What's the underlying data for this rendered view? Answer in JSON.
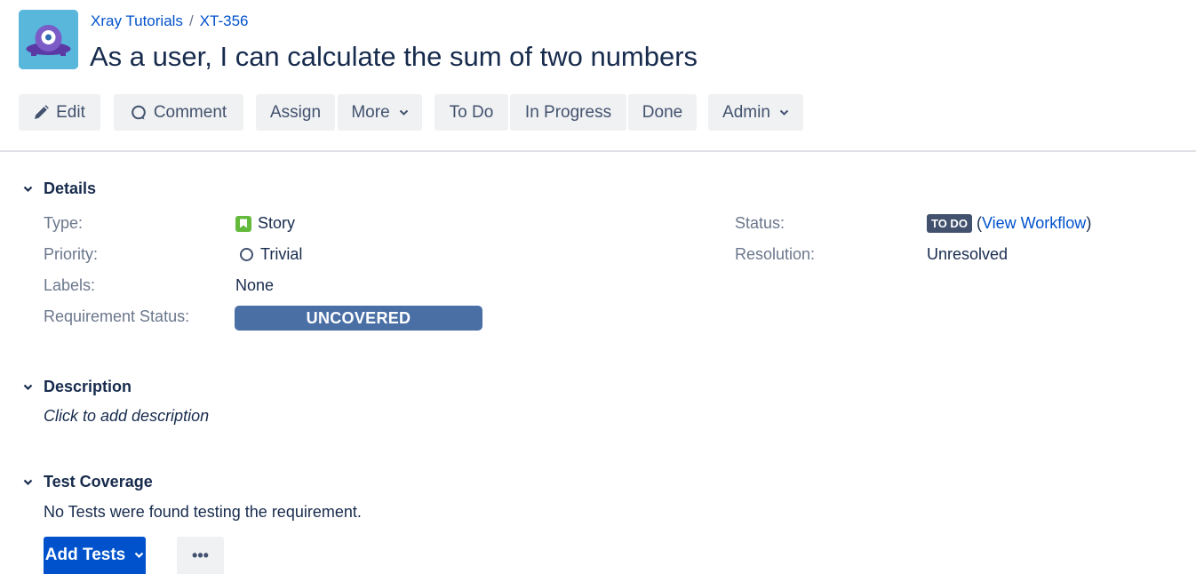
{
  "header": {
    "project": "Xray Tutorials",
    "separator": "/",
    "issue_key": "XT-356",
    "title": "As a user, I can calculate the sum of two numbers",
    "avatar_icon": "xray-project-avatar-icon"
  },
  "toolbar": {
    "edit": "Edit",
    "comment": "Comment",
    "assign": "Assign",
    "more": "More",
    "todo": "To Do",
    "in_progress": "In Progress",
    "done": "Done",
    "admin": "Admin"
  },
  "details": {
    "heading": "Details",
    "type_label": "Type:",
    "type_value": "Story",
    "priority_label": "Priority:",
    "priority_value": "Trivial",
    "labels_label": "Labels:",
    "labels_value": "None",
    "req_status_label": "Requirement Status:",
    "req_status_value": "UNCOVERED",
    "status_label": "Status:",
    "status_value": "TO DO",
    "status_link": "View Workflow",
    "resolution_label": "Resolution:",
    "resolution_value": "Unresolved"
  },
  "description": {
    "heading": "Description",
    "placeholder": "Click to add description"
  },
  "test_coverage": {
    "heading": "Test Coverage",
    "empty_text": "No Tests were found testing the requirement.",
    "add_tests": "Add Tests",
    "more": "•••"
  },
  "colors": {
    "primary": "#0052cc",
    "uncovered": "#4a6fa5",
    "story": "#63ba3c",
    "todo_lozenge": "#42526e"
  }
}
